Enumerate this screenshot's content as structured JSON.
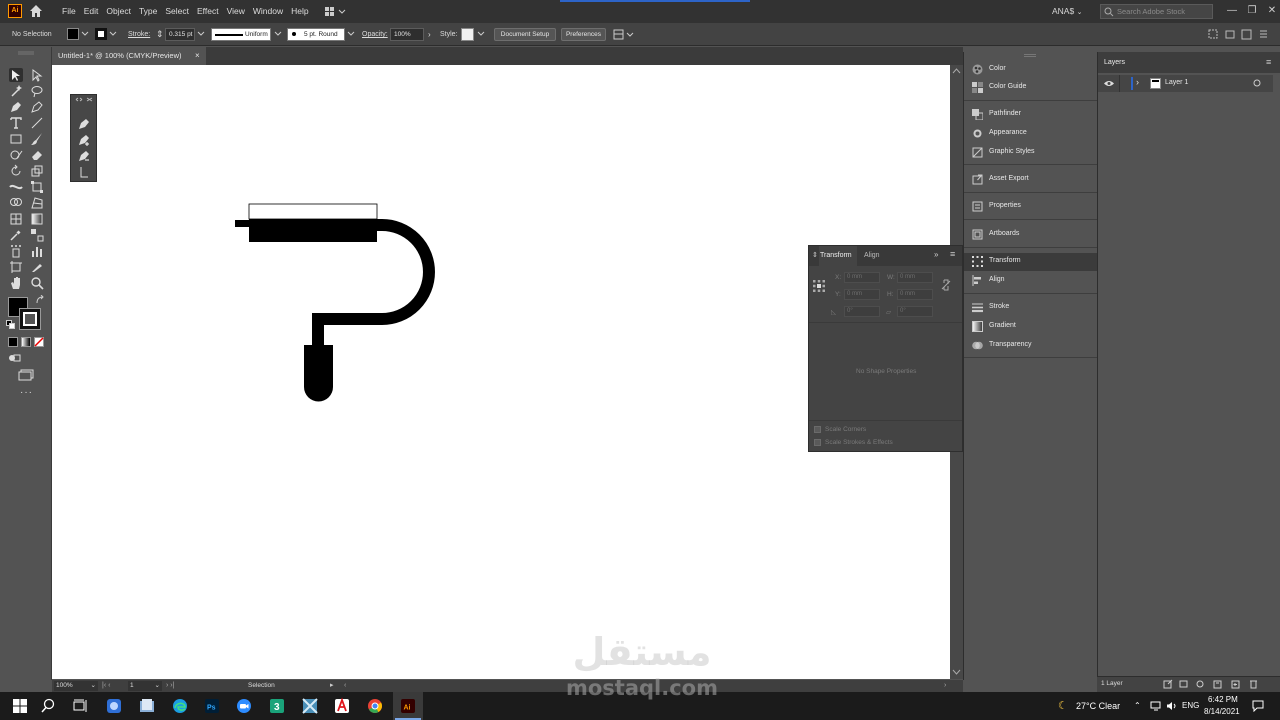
{
  "app": {
    "logo": "Ai",
    "menus": [
      "File",
      "Edit",
      "Object",
      "Type",
      "Select",
      "Effect",
      "View",
      "Window",
      "Help"
    ],
    "user": "ANA$",
    "search_placeholder": "Search Adobe Stock"
  },
  "control": {
    "selection": "No Selection",
    "stroke_label": "Stroke:",
    "stroke_weight": "0.315 pt",
    "profile": "Uniform",
    "brush": "5 pt. Round",
    "opacity_label": "Opacity:",
    "opacity": "100%",
    "style_label": "Style:",
    "doc_setup": "Document Setup",
    "preferences": "Preferences"
  },
  "document": {
    "tab_title": "Untitled-1* @ 100% (CMYK/Preview)",
    "close": "×"
  },
  "transform_panel": {
    "tabs": [
      "Transform",
      "Align"
    ],
    "x_label": "X:",
    "y_label": "Y:",
    "w_label": "W:",
    "h_label": "H:",
    "x_value": "0 mm",
    "y_value": "0 mm",
    "w_value": "0 mm",
    "h_value": "0 mm",
    "angle_value": "0°",
    "shear_value": "0°",
    "empty_message": "No Shape Properties",
    "scale_corners": "Scale Corners",
    "scale_strokes": "Scale Strokes & Effects"
  },
  "dock": {
    "items": [
      "Color",
      "Color Guide",
      "Pathfinder",
      "Appearance",
      "Graphic Styles",
      "Asset Export",
      "Properties",
      "Artboards",
      "Transform",
      "Align",
      "Stroke",
      "Gradient",
      "Transparency"
    ]
  },
  "layers": {
    "title": "Layers",
    "layer_name": "Layer 1",
    "footer": "1 Layer"
  },
  "status": {
    "zoom": "100%",
    "artboard": "1",
    "tool": "Selection"
  },
  "taskbar": {
    "weather": "27°C  Clear",
    "lang": "ENG",
    "time": "6:42 PM",
    "date": "8/14/2021"
  },
  "watermark": {
    "arabic": "مستقل",
    "latin": "mostaql.com"
  },
  "colors": {
    "accent": "#2d64c8",
    "ai_orange": "#ff9a00"
  }
}
